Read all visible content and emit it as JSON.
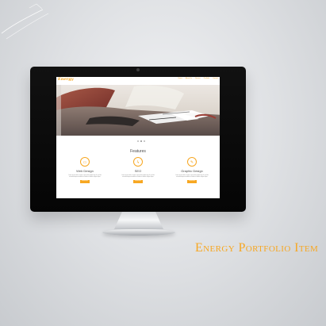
{
  "caption": "Energy Portfolio Item",
  "website": {
    "logo": "Energy",
    "nav": [
      "Home",
      "About Us",
      "Service",
      "Portfolio",
      "Contact"
    ],
    "carousel": {
      "active_slide": 2,
      "total_slides": 3
    },
    "features": {
      "title": "Features",
      "items": [
        {
          "title": "Web Design",
          "icon": "monitor-icon",
          "text": "Lorem ipsum dolor sit amet, consectetur adipiscing elit, sed do eiusmod tempor incididunt ut labore et dolore magna aliqua.",
          "button": "Read More"
        },
        {
          "title": "SEO",
          "icon": "lightning-icon",
          "text": "Lorem ipsum dolor sit amet, consectetur adipiscing elit, sed do eiusmod tempor incididunt ut labore et dolore magna aliqua.",
          "button": "Read More"
        },
        {
          "title": "Graphic Design",
          "icon": "pen-icon",
          "text": "Lorem ipsum dolor sit amet, consectetur adipiscing elit, sed do eiusmod tempor incididunt ut labore et dolore magna aliqua.",
          "button": "Read More"
        }
      ]
    }
  },
  "colors": {
    "accent": "#f7a722",
    "background": "#dfe1e4",
    "monitor": "#050505"
  }
}
